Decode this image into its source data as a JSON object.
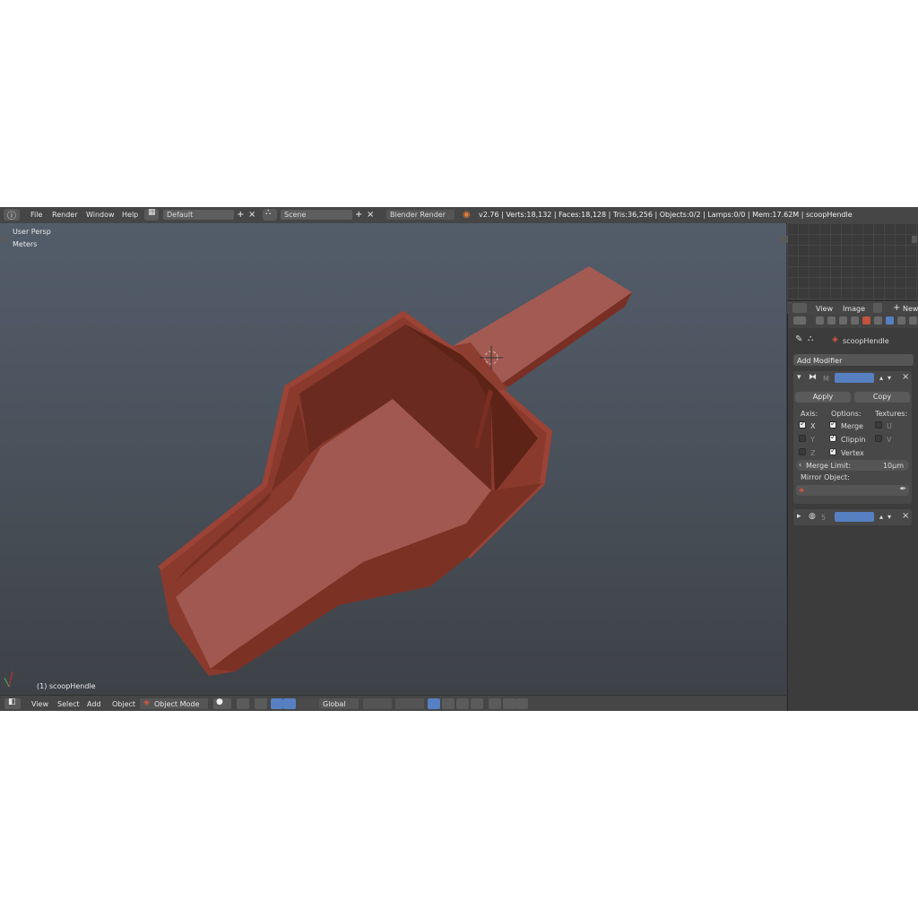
{
  "topbar": {
    "menus": [
      "File",
      "Render",
      "Window",
      "Help"
    ],
    "layout": "Default",
    "scene": "Scene",
    "engine": "Blender Render",
    "stats": "v2.76 | Verts:18,132 | Faces:18,128 | Tris:36,256 | Objects:0/2 | Lamps:0/0 | Mem:17.62M | scoopHendle"
  },
  "viewport": {
    "view_label": "User Persp",
    "units_label": "Meters",
    "object_label": "(1) scoopHendle",
    "object_color": "#8a3a2d"
  },
  "bottombar": {
    "menus": [
      "View",
      "Select",
      "Add",
      "Object"
    ],
    "mode": "Object Mode",
    "orientation": "Global"
  },
  "image_editor": {
    "menus": [
      "View",
      "Image"
    ],
    "new_label": "New"
  },
  "properties": {
    "object_name": "scoopHendle",
    "add_modifier": "Add Modifier",
    "modifier": {
      "name_abbr": "M",
      "apply": "Apply",
      "copy": "Copy",
      "axis_header": "Axis:",
      "options_header": "Options:",
      "textures_header": "Textures:",
      "axes": [
        {
          "label": "X",
          "on": true
        },
        {
          "label": "Y",
          "on": false
        },
        {
          "label": "Z",
          "on": false
        }
      ],
      "options": [
        {
          "label": "Merge",
          "on": true
        },
        {
          "label": "Clippin",
          "on": true
        },
        {
          "label": "Vertex",
          "on": true
        }
      ],
      "textures": [
        {
          "label": "U",
          "on": false
        },
        {
          "label": "V",
          "on": false
        }
      ],
      "merge_limit_label": "Merge Limit:",
      "merge_limit_value": "10µm",
      "mirror_object_label": "Mirror Object:"
    },
    "modifier2": {
      "levels": "5"
    }
  }
}
